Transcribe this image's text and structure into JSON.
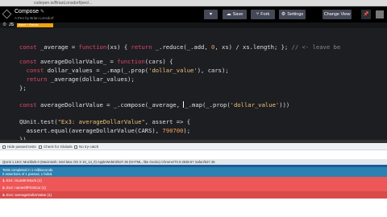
{
  "browser": {
    "url": "codepen.io/BrianLonsdorf/pen/..."
  },
  "header": {
    "title": "Compose",
    "author": "A Pen by Brian Lonsdorf",
    "buttons": {
      "save": "Save",
      "fork": "Fork",
      "settings": "Settings",
      "change_view": "Change View"
    }
  },
  "editor": {
    "language": "JS",
    "badge": "Babel + Ramda"
  },
  "qunit": {
    "toolbar": {
      "hide_passed": "Hide passed tests",
      "check_globals": "Check for Globals",
      "no_try_catch": "No try-catch"
    },
    "user_agent": "QUnit 1.18.0; Mozilla/5.0 (Macintosh; Intel Mac OS X 10_14_0) AppleWebKit/537.36 (KHTML, like Gecko) Chrome/70.0.3538.67 Safari/537.36",
    "summary_line1": "Tests completed in 1 milliseconds.",
    "summary_line2": "0 assertions of 1 passed, 1 failed.",
    "tests": [
      {
        "num": "1.",
        "label": "Ex1: isLastInStock (1)",
        "status": "fail"
      },
      {
        "num": "2.",
        "label": "Ex2: nameOfFirstCar (1)",
        "status": "fail"
      },
      {
        "num": "3.",
        "label": "Ex3: averageDollarValue (1)",
        "status": "fail"
      }
    ]
  },
  "colors": {
    "save": "#444857",
    "badge": "#f0a30a",
    "fail": "#ee5757",
    "pass": "#d9e8f3",
    "summary": "#2b81af"
  }
}
